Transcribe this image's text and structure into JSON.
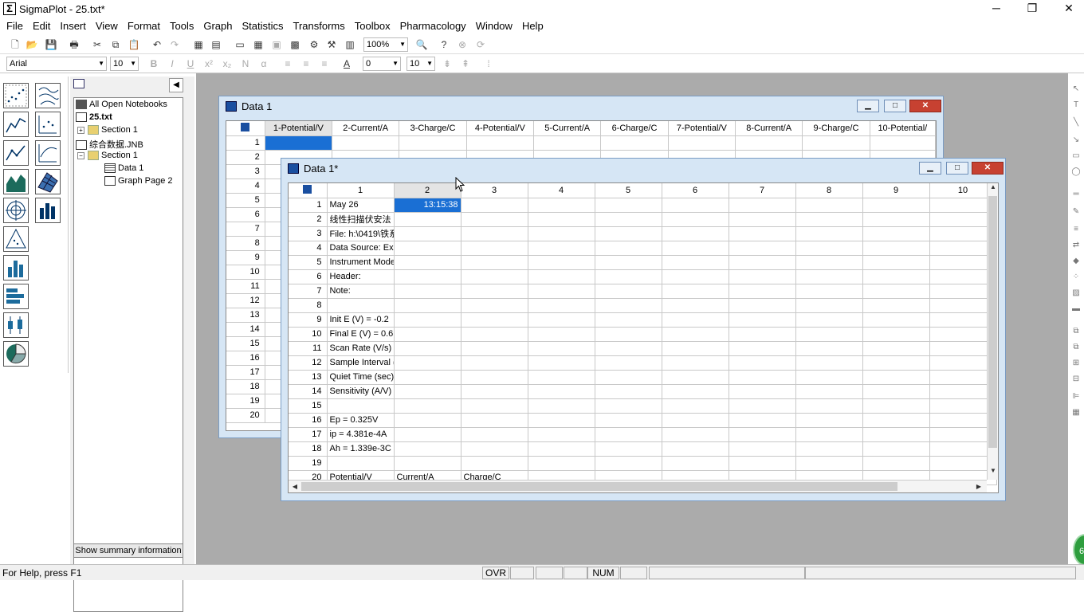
{
  "window": {
    "title": "SigmaPlot - 25.txt*"
  },
  "menu": [
    "File",
    "Edit",
    "Insert",
    "View",
    "Format",
    "Tools",
    "Graph",
    "Statistics",
    "Transforms",
    "Toolbox",
    "Pharmacology",
    "Window",
    "Help"
  ],
  "toolbar": {
    "zoom": "100%"
  },
  "formatbar": {
    "font": "Arial",
    "size": "10",
    "line_width": "0",
    "line_size": "10"
  },
  "notebook": {
    "root": "All Open Notebooks",
    "items": [
      {
        "label": "25.txt"
      },
      {
        "label": "Section 1"
      },
      {
        "label": "综合数据.JNB"
      },
      {
        "label": "Section 1"
      },
      {
        "label": "Data 1"
      },
      {
        "label": "Graph Page 2"
      }
    ],
    "summary_button": "Show summary information"
  },
  "data1_back": {
    "title": "Data 1",
    "columns": [
      "1-Potential/V",
      "2-Current/A",
      "3-Charge/C",
      "4-Potential/V",
      "5-Current/A",
      "6-Charge/C",
      "7-Potential/V",
      "8-Current/A",
      "9-Charge/C",
      "10-Potential/"
    ],
    "rows": [
      "1",
      "2",
      "3",
      "4",
      "5",
      "6",
      "7",
      "8",
      "9",
      "10",
      "11",
      "12",
      "13",
      "14",
      "15",
      "16",
      "17",
      "18",
      "19",
      "20"
    ]
  },
  "data1_front": {
    "title": "Data 1*",
    "columns": [
      "1",
      "2",
      "3",
      "4",
      "5",
      "6",
      "7",
      "8",
      "9",
      "10"
    ],
    "rows": [
      {
        "n": "1",
        "c1": "May 26",
        "c2": "13:15:38",
        "c3": ""
      },
      {
        "n": "2",
        "c1": "线性扫描伏安法",
        "c2": "",
        "c3": ""
      },
      {
        "n": "3",
        "c1": "File: h:\\0419\\铁系",
        "c2": "",
        "c3": ""
      },
      {
        "n": "4",
        "c1": "Data Source: Ex",
        "c2": "",
        "c3": ""
      },
      {
        "n": "5",
        "c1": "Instrument Mode",
        "c2": "",
        "c3": ""
      },
      {
        "n": "6",
        "c1": "Header:",
        "c2": "",
        "c3": ""
      },
      {
        "n": "7",
        "c1": "Note:",
        "c2": "",
        "c3": ""
      },
      {
        "n": "8",
        "c1": "",
        "c2": "",
        "c3": ""
      },
      {
        "n": "9",
        "c1": "Init E (V) = -0.2",
        "c2": "",
        "c3": ""
      },
      {
        "n": "10",
        "c1": "Final E (V) = 0.6",
        "c2": "",
        "c3": ""
      },
      {
        "n": "11",
        "c1": "Scan Rate (V/s)",
        "c2": "",
        "c3": ""
      },
      {
        "n": "12",
        "c1": "Sample Interval (",
        "c2": "",
        "c3": ""
      },
      {
        "n": "13",
        "c1": "Quiet Time (sec)",
        "c2": "",
        "c3": ""
      },
      {
        "n": "14",
        "c1": "Sensitivity (A/V)",
        "c2": "",
        "c3": ""
      },
      {
        "n": "15",
        "c1": "",
        "c2": "",
        "c3": ""
      },
      {
        "n": "16",
        "c1": "Ep = 0.325V",
        "c2": "",
        "c3": ""
      },
      {
        "n": "17",
        "c1": "ip = 4.381e-4A",
        "c2": "",
        "c3": ""
      },
      {
        "n": "18",
        "c1": "Ah = 1.339e-3C",
        "c2": "",
        "c3": ""
      },
      {
        "n": "19",
        "c1": "",
        "c2": "",
        "c3": ""
      },
      {
        "n": "20",
        "c1": "Potential/V",
        "c2": "Current/A",
        "c3": "Charge/C"
      }
    ]
  },
  "status": {
    "help": "For Help, press F1",
    "ovr": "OVR",
    "num": "NUM"
  },
  "colors": {
    "selection": "#1a6fd4",
    "workspace": "#ababab",
    "mdi_frame": "#d6e6f5"
  }
}
